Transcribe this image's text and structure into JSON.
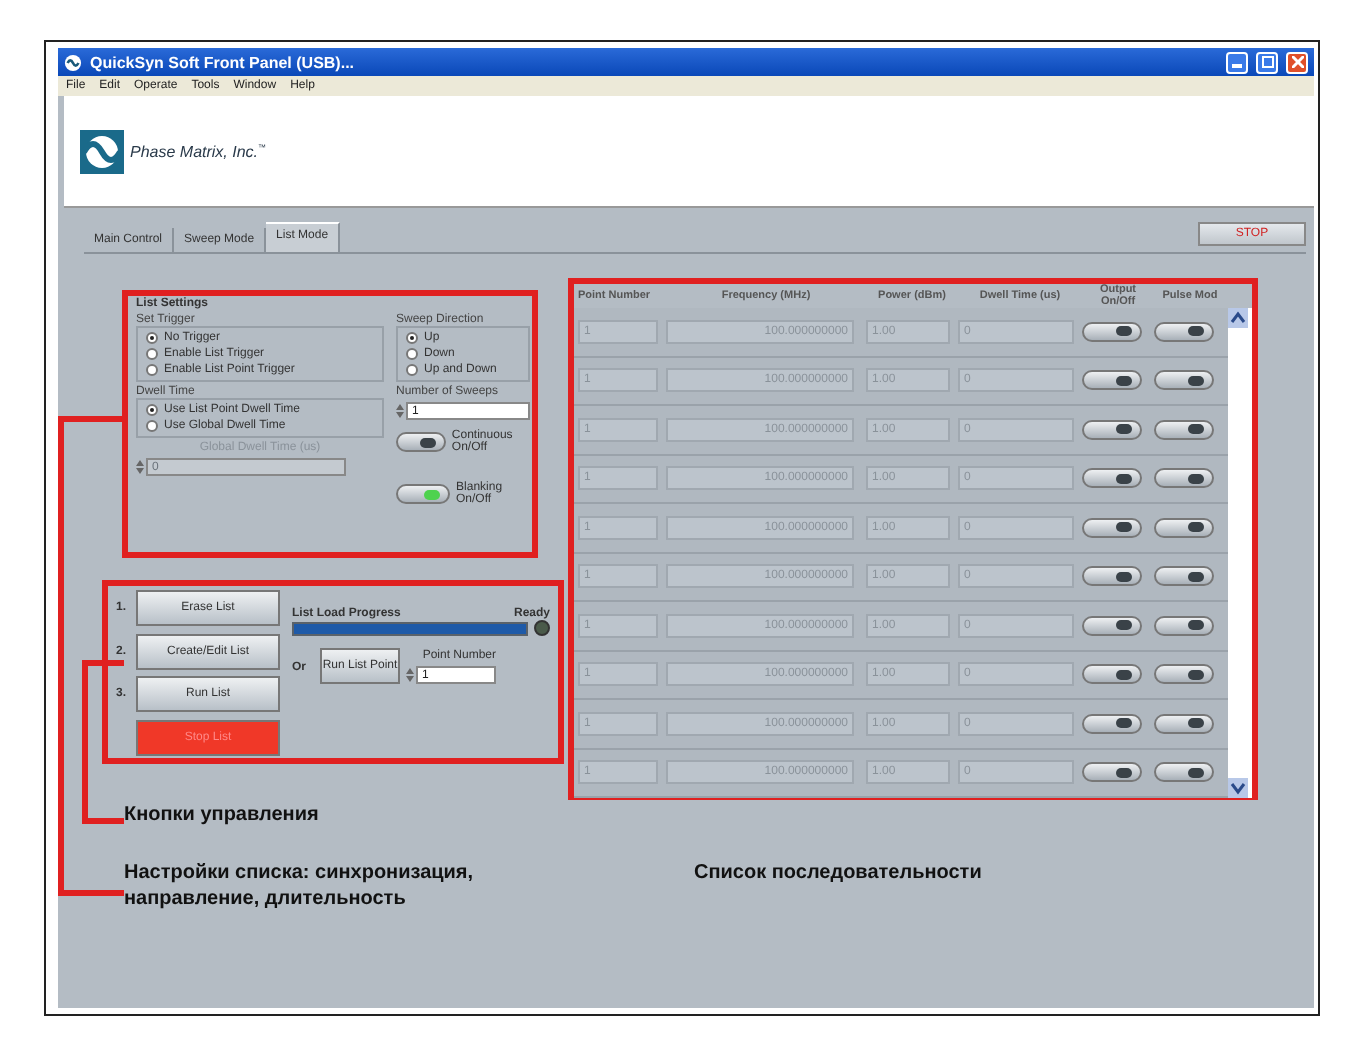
{
  "window": {
    "title": "QuickSyn Soft Front Panel (USB)..."
  },
  "menu": [
    "File",
    "Edit",
    "Operate",
    "Tools",
    "Window",
    "Help"
  ],
  "logo": {
    "text": "Phase Matrix, Inc.$^{™}$"
  },
  "tabs": [
    {
      "label": "Main Control",
      "selected": false
    },
    {
      "label": "Sweep Mode",
      "selected": false
    },
    {
      "label": "List Mode",
      "selected": true
    }
  ],
  "stop_button": "STOP",
  "list_settings": {
    "title": "List Settings",
    "set_trigger": {
      "label": "Set Trigger",
      "options": [
        {
          "label": "No Trigger",
          "selected": true
        },
        {
          "label": "Enable List Trigger",
          "selected": false
        },
        {
          "label": "Enable List Point Trigger",
          "selected": false
        }
      ]
    },
    "sweep_direction": {
      "label": "Sweep Direction",
      "options": [
        {
          "label": "Up",
          "selected": true
        },
        {
          "label": "Down",
          "selected": false
        },
        {
          "label": "Up and Down",
          "selected": false
        }
      ]
    },
    "dwell_time": {
      "label": "Dwell Time",
      "options": [
        {
          "label": "Use List Point Dwell Time",
          "selected": true
        },
        {
          "label": "Use Global Dwell Time",
          "selected": false
        }
      ]
    },
    "number_of_sweeps": {
      "label": "Number of Sweeps",
      "value": "1"
    },
    "continuous": {
      "label": "Continuous On/Off",
      "on": false
    },
    "global_dwell": {
      "label": "Global Dwell Time (us)",
      "value": "0",
      "disabled": true
    },
    "blanking": {
      "label": "Blanking On/Off",
      "on": true
    }
  },
  "list_controls": {
    "steps": [
      {
        "number": "1.",
        "label": "Erase List"
      },
      {
        "number": "2.",
        "label": "Create/Edit List"
      },
      {
        "number": "3.",
        "label": "Run List"
      }
    ],
    "stop": "Stop List",
    "progress": {
      "label": "List Load Progress",
      "level": 1
    },
    "ready": {
      "label": "Ready",
      "on": false
    },
    "or": "Or",
    "run_point": "Run List Point",
    "point_number": {
      "label": "Point Number",
      "value": "1"
    }
  },
  "table": {
    "columns": [
      "Point Number",
      "Frequency (MHz)",
      "Power (dBm)",
      "Dwell Time (us)",
      "Output On/Off",
      "Pulse Mod"
    ],
    "rows": [
      {
        "point": "1",
        "frequency": "100.000000000",
        "power": "1.00",
        "dwell": "0",
        "output_on": false,
        "pulse_mod": false
      },
      {
        "point": "1",
        "frequency": "100.000000000",
        "power": "1.00",
        "dwell": "0",
        "output_on": false,
        "pulse_mod": false
      },
      {
        "point": "1",
        "frequency": "100.000000000",
        "power": "1.00",
        "dwell": "0",
        "output_on": false,
        "pulse_mod": false
      },
      {
        "point": "1",
        "frequency": "100.000000000",
        "power": "1.00",
        "dwell": "0",
        "output_on": false,
        "pulse_mod": false
      },
      {
        "point": "1",
        "frequency": "100.000000000",
        "power": "1.00",
        "dwell": "0",
        "output_on": false,
        "pulse_mod": false
      },
      {
        "point": "1",
        "frequency": "100.000000000",
        "power": "1.00",
        "dwell": "0",
        "output_on": false,
        "pulse_mod": false
      },
      {
        "point": "1",
        "frequency": "100.000000000",
        "power": "1.00",
        "dwell": "0",
        "output_on": false,
        "pulse_mod": false
      },
      {
        "point": "1",
        "frequency": "100.000000000",
        "power": "1.00",
        "dwell": "0",
        "output_on": false,
        "pulse_mod": false
      },
      {
        "point": "1",
        "frequency": "100.000000000",
        "power": "1.00",
        "dwell": "0",
        "output_on": false,
        "pulse_mod": false
      },
      {
        "point": "1",
        "frequency": "100.000000000",
        "power": "1.00",
        "dwell": "0",
        "output_on": false,
        "pulse_mod": false
      }
    ]
  },
  "annotations": {
    "controls": "Кнопки управления",
    "settings": [
      "Настройки списка: синхронизация,",
      "направление, длительность"
    ],
    "sequence": "Список последовательности"
  }
}
